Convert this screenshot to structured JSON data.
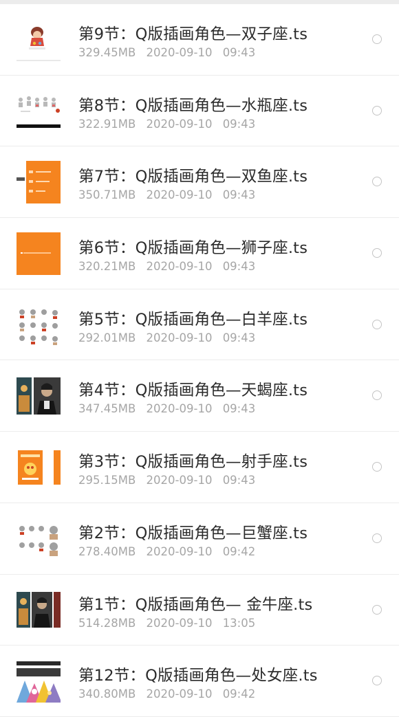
{
  "files": [
    {
      "name": "第9节：Q版插画角色—双子座.ts",
      "size": "329.45MB",
      "date": "2020-09-10",
      "time": "09:43",
      "thumb_icon": "cartoon-doll-thumbnail-icon"
    },
    {
      "name": "第8节：Q版插画角色—水瓶座.ts",
      "size": "322.91MB",
      "date": "2020-09-10",
      "time": "09:43",
      "thumb_icon": "sticker-sheet-thumbnail-icon"
    },
    {
      "name": "第7节：Q版插画角色—双鱼座.ts",
      "size": "350.71MB",
      "date": "2020-09-10",
      "time": "09:43",
      "thumb_icon": "orange-slide-list-thumbnail-icon"
    },
    {
      "name": "第6节：Q版插画角色—狮子座.ts",
      "size": "320.21MB",
      "date": "2020-09-10",
      "time": "09:43",
      "thumb_icon": "orange-slide-thumbnail-icon"
    },
    {
      "name": "第5节：Q版插画角色—白羊座.ts",
      "size": "292.01MB",
      "date": "2020-09-10",
      "time": "09:43",
      "thumb_icon": "sticker-sheet-thumbnail-icon"
    },
    {
      "name": "第4节：Q版插画角色—天蝎座.ts",
      "size": "347.45MB",
      "date": "2020-09-10",
      "time": "09:43",
      "thumb_icon": "portrait-photo-thumbnail-icon"
    },
    {
      "name": "第3节：Q版插画角色—射手座.ts",
      "size": "295.15MB",
      "date": "2020-09-10",
      "time": "09:43",
      "thumb_icon": "orange-poster-thumbnail-icon"
    },
    {
      "name": "第2节：Q版插画角色—巨蟹座.ts",
      "size": "278.40MB",
      "date": "2020-09-10",
      "time": "09:42",
      "thumb_icon": "sticker-sheet-thumbnail-icon"
    },
    {
      "name": "第1节：Q版插画角色— 金牛座.ts",
      "size": "514.28MB",
      "date": "2020-09-10",
      "time": "13:05",
      "thumb_icon": "portrait-photo-thumbnail-icon"
    },
    {
      "name": "第12节：Q版插画角色—处女座.ts",
      "size": "340.80MB",
      "date": "2020-09-10",
      "time": "09:42",
      "thumb_icon": "colorful-triangles-thumbnail-icon"
    }
  ],
  "colors": {
    "row_background": "#ffffff",
    "page_background": "#f3f3f3",
    "title_text": "#2b2b2b",
    "meta_text": "#a6a6a6",
    "radio_border": "#c4c4c4",
    "thumb_orange": "#f5841f"
  }
}
